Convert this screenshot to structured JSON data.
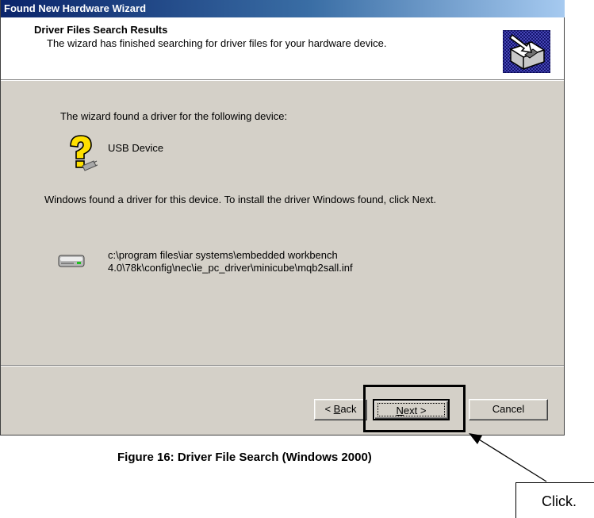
{
  "window": {
    "title": "Found New Hardware Wizard"
  },
  "header": {
    "heading": "Driver Files Search Results",
    "subtitle": "The wizard has finished searching for driver files for your hardware device.",
    "emblem_icon": "hardware-wizard-icon"
  },
  "body": {
    "intro": "The wizard found a driver for the following device:",
    "device_icon": "unknown-device-icon",
    "device_name": "USB Device",
    "instruction": "Windows found a driver for this device. To install the driver Windows found, click Next.",
    "driver_icon": "drive-icon",
    "driver_path_line1": "c:\\program files\\iar systems\\embedded workbench",
    "driver_path_line2": "4.0\\78k\\config\\nec\\ie_pc_driver\\minicube\\mqb2sall.inf"
  },
  "buttons": {
    "back": {
      "prefix": "< ",
      "mnemonic": "B",
      "rest": "ack"
    },
    "next": {
      "mnemonic": "N",
      "rest": "ext >"
    },
    "cancel": "Cancel"
  },
  "annotation": {
    "caption": "Figure 16: Driver File Search (Windows 2000)",
    "callout": "Click."
  },
  "colors": {
    "titlebar_start": "#0a246a",
    "titlebar_end": "#a6caf0",
    "dialog_face": "#d4d0c8",
    "header_background": "#ffffff",
    "highlight": "#000000"
  }
}
